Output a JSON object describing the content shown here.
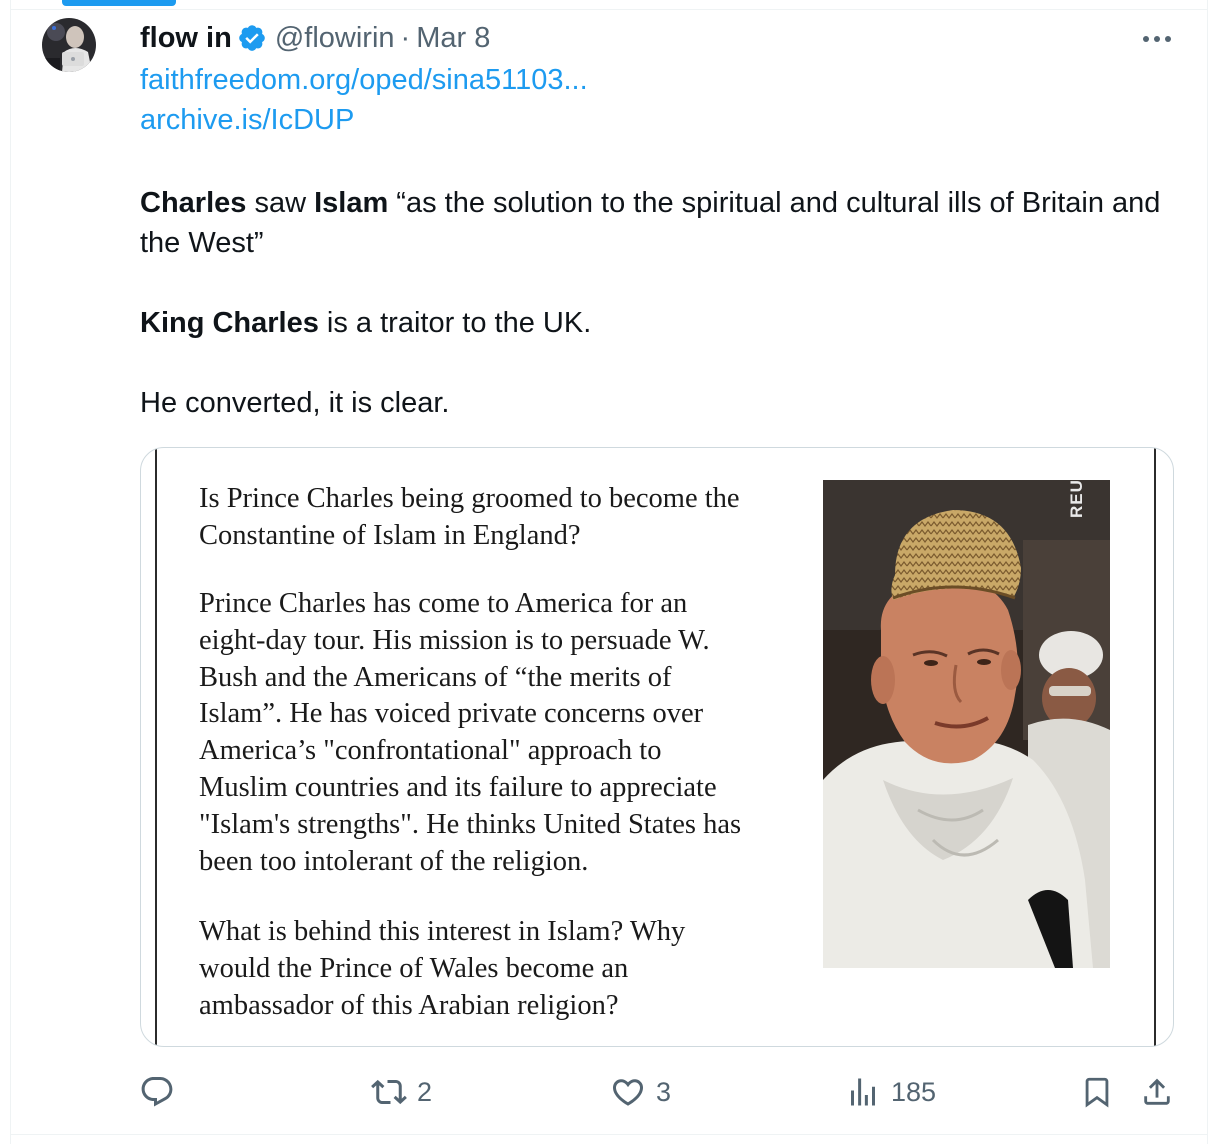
{
  "tweet": {
    "author": {
      "display_name": "flow in",
      "handle": "@flowirin",
      "separator": "·",
      "date": "Mar 8",
      "verified": true
    },
    "links": [
      "faithfreedom.org/oped/sina51103...",
      "archive.is/IcDUP"
    ],
    "body": {
      "p1": {
        "bold1": "Charles",
        "t1": " saw ",
        "bold2": "Islam",
        "t2": " “as the solution to the spiritual and cultural ills of Britain and the West”"
      },
      "p2": {
        "bold1": "King Charles",
        "t1": " is a traitor to the UK."
      },
      "p3": "He converted, it is clear."
    },
    "media": {
      "heading_lines": [
        "Is Prince Charles being groomed to become the",
        "Constantine of Islam in England?"
      ],
      "paragraph_lines": [
        "Prince Charles has come to America for an",
        "eight-day tour. His mission is to persuade W.",
        "Bush and the Americans of “the merits of",
        "Islam”. He has voiced private concerns over",
        "America’s \"confrontational\" approach to",
        "Muslim countries and its failure to appreciate",
        "\"Islam's strengths\". He thinks United States has",
        "been too intolerant of the religion."
      ],
      "question_lines": [
        "What is behind this interest in Islam? Why",
        "would the Prince of Wales become an",
        "ambassador of this Arabian religion?"
      ],
      "photo_credit": "REUTERS"
    },
    "actions": {
      "reply_count": "",
      "retweet_count": "2",
      "like_count": "3",
      "views_count": "185"
    }
  },
  "icons": [
    "verified-badge-icon",
    "more-icon",
    "reply-icon",
    "retweet-icon",
    "like-icon",
    "views-icon",
    "bookmark-icon",
    "share-icon"
  ],
  "colors": {
    "accent": "#1d9bf0",
    "text_primary": "#0f1419",
    "text_secondary": "#536471",
    "border": "#cfd9de"
  }
}
